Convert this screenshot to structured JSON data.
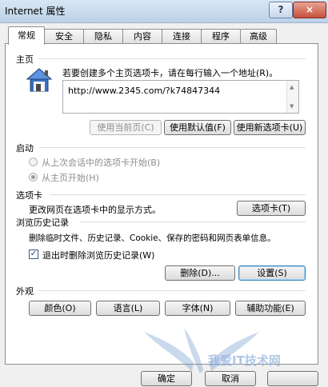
{
  "window": {
    "title": "Internet 属性",
    "help": "?",
    "close": "×"
  },
  "tabs": [
    "常规",
    "安全",
    "隐私",
    "内容",
    "连接",
    "程序",
    "高级"
  ],
  "home": {
    "section": "主页",
    "description": "若要创建多个主页选项卡，请在每行输入一个地址(R)。",
    "url": "http://www.2345.com/?k74847344",
    "buttons": [
      "使用当前页(C)",
      "使用默认值(F)",
      "使用新选项卡(U)"
    ]
  },
  "startup": {
    "section": "启动",
    "options": [
      "从上次会话中的选项卡开始(B)",
      "从主页开始(H)"
    ]
  },
  "tabs_section": {
    "section": "选项卡",
    "description": "更改网页在选项卡中的显示方式。",
    "button": "选项卡(T)"
  },
  "history": {
    "section": "浏览历史记录",
    "description": "删除临时文件、历史记录、Cookie、保存的密码和网页表单信息。",
    "checkbox": "退出时删除浏览历史记录(W)",
    "checkmark": "✓",
    "delete_button": "删除(D)...",
    "settings_button": "设置(S)"
  },
  "appearance": {
    "section": "外观",
    "buttons": [
      "颜色(O)",
      "语言(L)",
      "字体(N)",
      "辅助功能(E)"
    ]
  },
  "footer": {
    "ok": "确定",
    "cancel": "取消"
  },
  "watermark": "我爱IT技术网"
}
